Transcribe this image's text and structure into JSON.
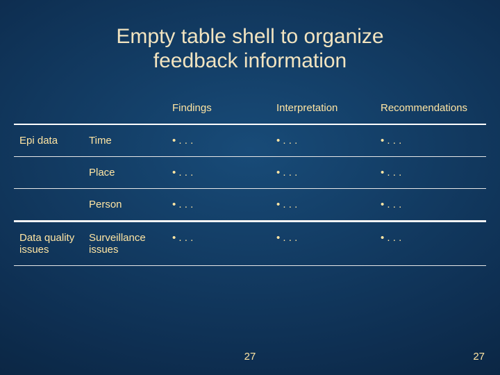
{
  "title_line1": "Empty table shell to organize",
  "title_line2": "feedback information",
  "headers": {
    "col0": "",
    "col1": "",
    "col2": "Findings",
    "col3": "Interpretation",
    "col4": "Recommendations"
  },
  "rows": [
    {
      "group": "Epi data",
      "sub": "Time",
      "f": "• . . .",
      "i": "• . . .",
      "r": "• . . ."
    },
    {
      "group": "",
      "sub": "Place",
      "f": "• . . .",
      "i": "• . . .",
      "r": "• . . ."
    },
    {
      "group": "",
      "sub": "Person",
      "f": "• . . .",
      "i": "• . . .",
      "r": "• . . ."
    },
    {
      "group": "Data quality issues",
      "sub": "Surveillance issues",
      "f": "• . . .",
      "i": "• . . .",
      "r": "• . . ."
    }
  ],
  "page_center": "27",
  "page_right": "27"
}
